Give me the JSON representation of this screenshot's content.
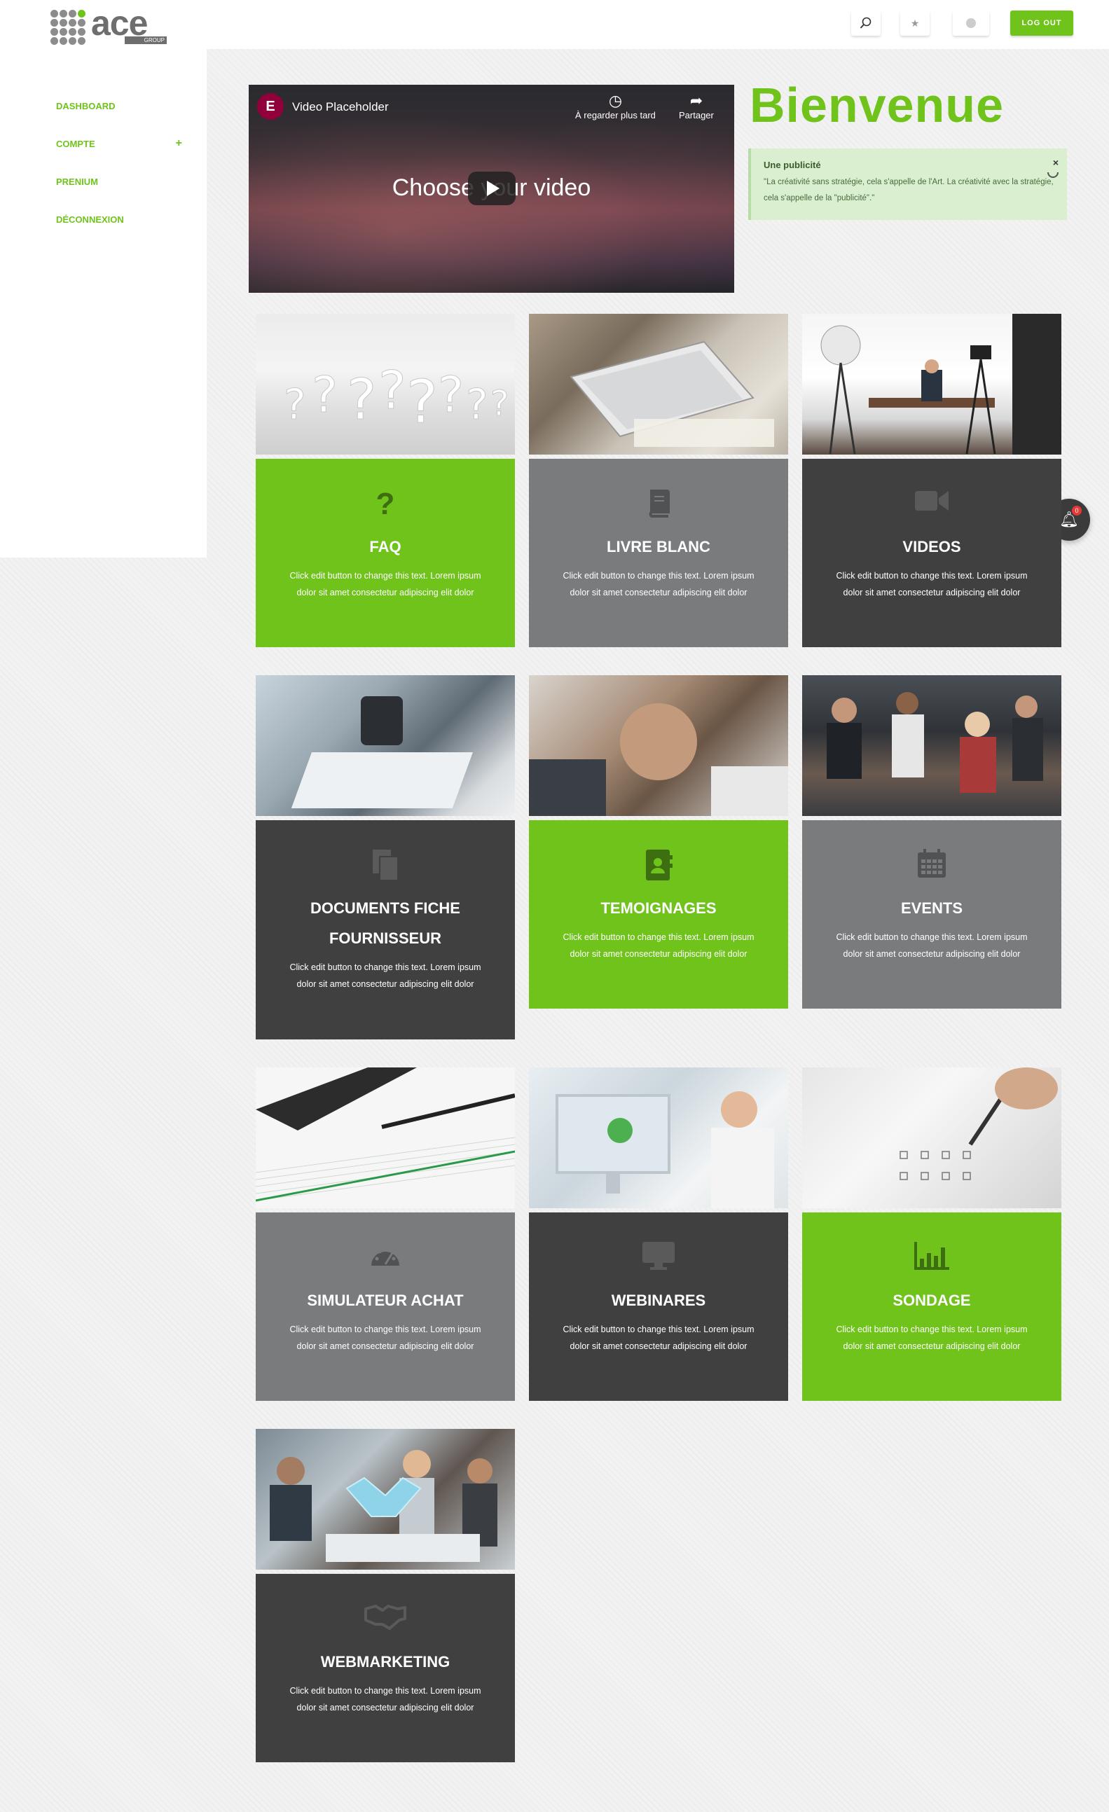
{
  "header": {
    "logo_word": "ace",
    "logo_sub": "GROUP",
    "search_icon": "magnifier",
    "favorites_icon": "star",
    "user_icon": "user-circle",
    "logout_label": "LOG OUT"
  },
  "sidebar": {
    "items": [
      {
        "label": "DASHBOARD"
      },
      {
        "label": "COMPTE",
        "expand": "+"
      },
      {
        "label": "PRENIUM"
      },
      {
        "label": "DÉCONNEXION"
      }
    ]
  },
  "video": {
    "logo_letter": "E",
    "title": "Video Placeholder",
    "watch_later": "À regarder plus tard",
    "share": "Partager",
    "center_text": "Choose your video"
  },
  "welcome": {
    "heading": "Bienvenue",
    "ad_title": "Une publicité",
    "ad_text": "\"La créativité sans stratégie, cela s'appelle de l'Art. La créativité avec la stratégie, cela s'appelle de la \"publicité\".\"",
    "ad_close": "×"
  },
  "notification": {
    "count": "0",
    "icon": "bell"
  },
  "colors": {
    "accent": "#6fc31b",
    "grey": "#797b7d",
    "dark": "#404040"
  },
  "cards": [
    {
      "title": "FAQ",
      "icon": "question-icon",
      "style": "green",
      "text": "Click edit button to change this text. Lorem ipsum dolor sit amet consectetur adipiscing elit dolor"
    },
    {
      "title": "LIVRE BLANC",
      "icon": "book-icon",
      "style": "grey",
      "text": "Click edit button to change this text. Lorem ipsum dolor sit amet consectetur adipiscing elit dolor"
    },
    {
      "title": "VIDEOS",
      "icon": "video-camera-icon",
      "style": "dark",
      "text": "Click edit button to change this text. Lorem ipsum dolor sit amet consectetur adipiscing elit dolor"
    },
    {
      "title": "DOCUMENTS FICHE FOURNISSEUR",
      "icon": "documents-icon",
      "style": "dark",
      "text": "Click edit button to change this text. Lorem ipsum dolor sit amet consectetur adipiscing elit dolor"
    },
    {
      "title": "TEMOIGNAGES",
      "icon": "address-book-icon",
      "style": "green",
      "text": "Click edit button to change this text. Lorem ipsum dolor sit amet consectetur adipiscing elit dolor"
    },
    {
      "title": "EVENTS",
      "icon": "calendar-icon",
      "style": "grey",
      "text": "Click edit button to change this text. Lorem ipsum dolor sit amet consectetur adipiscing elit dolor"
    },
    {
      "title": "SIMULATEUR ACHAT",
      "icon": "gauge-icon",
      "style": "grey",
      "text": "Click edit button to change this text. Lorem ipsum dolor sit amet consectetur adipiscing elit dolor"
    },
    {
      "title": "WEBINARES",
      "icon": "desktop-icon",
      "style": "dark",
      "text": "Click edit button to change this text. Lorem ipsum dolor sit amet consectetur adipiscing elit dolor"
    },
    {
      "title": "SONDAGE",
      "icon": "bar-chart-icon",
      "style": "green",
      "text": "Click edit button to change this text. Lorem ipsum dolor sit amet consectetur adipiscing elit dolor"
    },
    {
      "title": "WEBMARKETING",
      "icon": "handshake-icon",
      "style": "dark",
      "text": "Click edit button to change this text. Lorem ipsum dolor sit amet consectetur adipiscing elit dolor"
    }
  ]
}
